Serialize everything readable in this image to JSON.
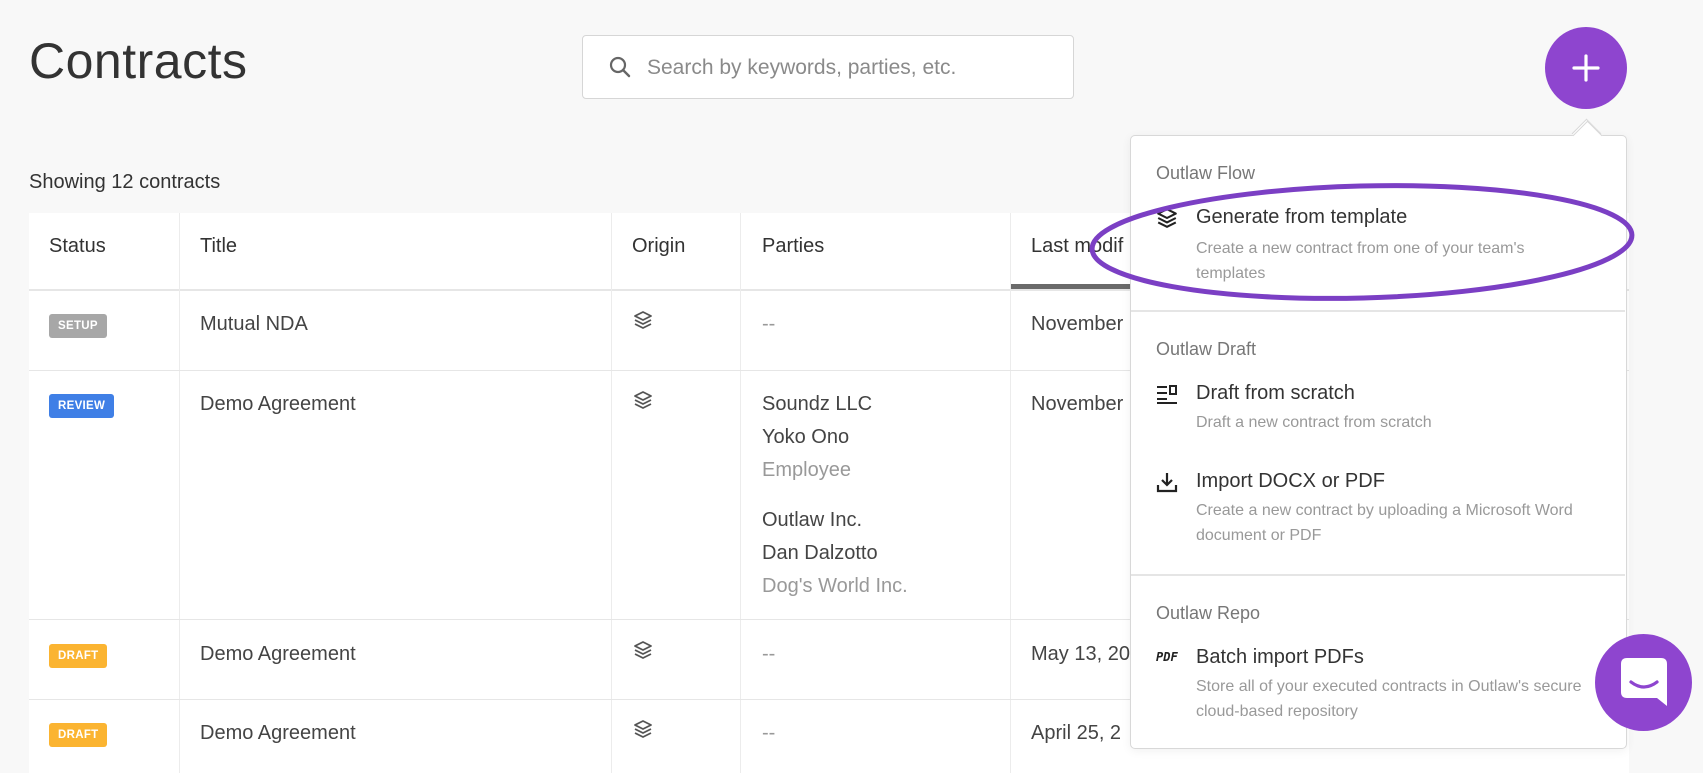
{
  "header": {
    "title": "Contracts",
    "search_placeholder": "Search by keywords, parties, etc.",
    "add_label": "+"
  },
  "list": {
    "count_text": "Showing 12 contracts"
  },
  "table": {
    "columns": [
      "Status",
      "Title",
      "Origin",
      "Parties",
      "Last modif"
    ],
    "rows": [
      {
        "status": "SETUP",
        "status_color": "#a7a7a7",
        "title": "Mutual NDA",
        "parties_dash": "--",
        "modified": "November"
      },
      {
        "status": "REVIEW",
        "status_color": "#3f7fe6",
        "title": "Demo Agreement",
        "party_a": {
          "name": "Soundz LLC",
          "person": "Yoko Ono",
          "role": "Employee"
        },
        "party_b": {
          "name": "Outlaw Inc.",
          "person": "Dan Dalzotto",
          "role": "Dog's World Inc."
        },
        "modified": "November"
      },
      {
        "status": "DRAFT",
        "status_color": "#fbb431",
        "title": "Demo Agreement",
        "parties_dash": "--",
        "modified": "May 13, 20"
      },
      {
        "status": "DRAFT",
        "status_color": "#fbb431",
        "title": "Demo Agreement",
        "parties_dash": "--",
        "modified": "April 25, 2"
      }
    ]
  },
  "menu": {
    "sections": [
      {
        "title": "Outlaw Flow",
        "items": [
          {
            "label": "Generate from template",
            "desc": "Create a new contract from one of your team's templates",
            "icon": "layers-icon"
          }
        ]
      },
      {
        "title": "Outlaw Draft",
        "items": [
          {
            "label": "Draft from scratch",
            "desc": "Draft a new contract from scratch",
            "icon": "draft-icon"
          },
          {
            "label": "Import DOCX or PDF",
            "desc": "Create a new contract by uploading a Microsoft Word document or PDF",
            "icon": "download-icon"
          }
        ]
      },
      {
        "title": "Outlaw Repo",
        "items": [
          {
            "label": "Batch import PDFs",
            "desc": "Store all of your executed contracts in Outlaw's secure cloud-based repository",
            "icon": "pdf-icon",
            "icon_text": "PDF"
          }
        ]
      }
    ]
  },
  "colors": {
    "accent": "#8e45cf",
    "highlight_ellipse": "#7b3fc4"
  }
}
